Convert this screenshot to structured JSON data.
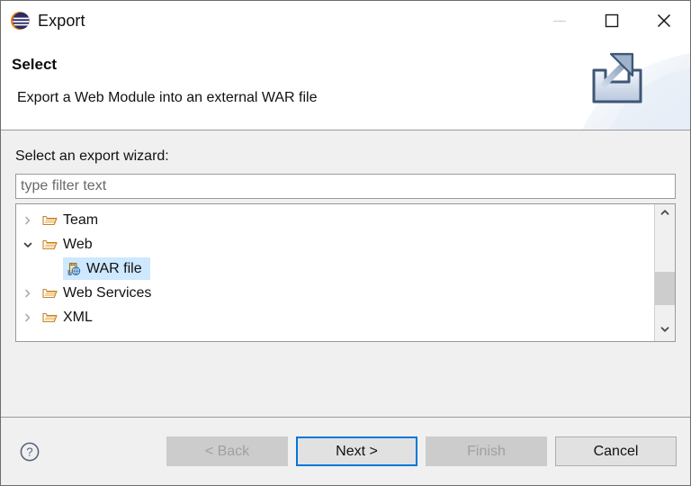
{
  "window": {
    "title": "Export",
    "app_icon": "eclipse-icon",
    "controls": [
      {
        "name": "minimize-button",
        "glyph": "minimize-icon",
        "enabled": false
      },
      {
        "name": "maximize-button",
        "glyph": "maximize-icon",
        "enabled": true
      },
      {
        "name": "close-button",
        "glyph": "close-icon",
        "enabled": true
      }
    ]
  },
  "header": {
    "title": "Select",
    "description": "Export a Web Module into an external WAR file",
    "banner_icon": "export-tray-arrow-icon"
  },
  "main": {
    "field_label": "Select an export wizard:",
    "filter": {
      "value": "",
      "placeholder": "type filter text"
    },
    "tree": [
      {
        "label": "Team",
        "icon": "folder-icon",
        "twisty": "chevron-right-icon",
        "expanded": false,
        "level": 0,
        "selected": false
      },
      {
        "label": "Web",
        "icon": "folder-icon",
        "twisty": "chevron-down-icon",
        "expanded": true,
        "level": 0,
        "selected": false
      },
      {
        "label": "WAR file",
        "icon": "war-file-icon",
        "twisty": "none",
        "expanded": false,
        "level": 1,
        "selected": true
      },
      {
        "label": "Web Services",
        "icon": "folder-icon",
        "twisty": "chevron-right-icon",
        "expanded": false,
        "level": 0,
        "selected": false
      },
      {
        "label": "XML",
        "icon": "folder-icon",
        "twisty": "chevron-right-icon",
        "expanded": false,
        "level": 0,
        "selected": false
      }
    ],
    "scrollbar": {
      "up_icon": "chevron-up-icon",
      "down_icon": "chevron-down-icon"
    }
  },
  "footer": {
    "help_icon": "help-question-icon",
    "buttons": [
      {
        "label": "< Back",
        "name": "back-button",
        "state": "disabled"
      },
      {
        "label": "Next >",
        "name": "next-button",
        "state": "default"
      },
      {
        "label": "Finish",
        "name": "finish-button",
        "state": "disabled"
      },
      {
        "label": "Cancel",
        "name": "cancel-button",
        "state": "enabled"
      }
    ]
  },
  "colors": {
    "accent": "#0078d7",
    "selection": "#cde8ff",
    "dialog_bg": "#f0f0f0",
    "field_bg": "#ffffff",
    "border": "#9a9a9a",
    "disabled_text": "#a0a0a0"
  }
}
